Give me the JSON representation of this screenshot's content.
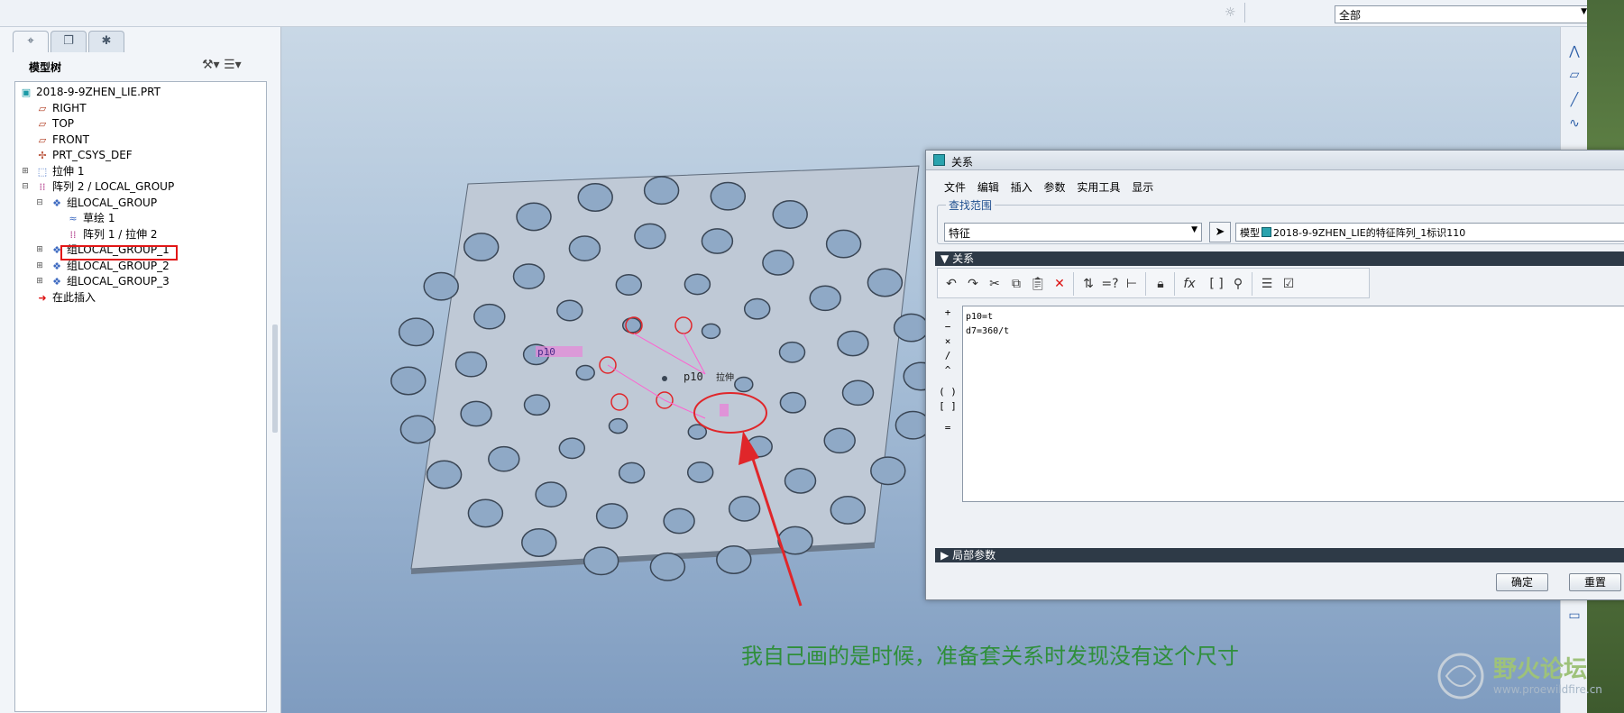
{
  "toolbar": {
    "filter_value": "全部"
  },
  "navigator": {
    "tree_title": "模型树",
    "items": [
      {
        "label": "2018-9-9ZHEN_LIE.PRT",
        "icon": "part-icon"
      },
      {
        "label": "RIGHT",
        "icon": "datum-plane-icon"
      },
      {
        "label": "TOP",
        "icon": "datum-plane-icon"
      },
      {
        "label": "FRONT",
        "icon": "datum-plane-icon"
      },
      {
        "label": "PRT_CSYS_DEF",
        "icon": "csys-icon"
      },
      {
        "label": "拉伸 1",
        "icon": "extrude-icon"
      },
      {
        "label": "阵列 2 / LOCAL_GROUP",
        "icon": "pattern-icon"
      },
      {
        "label": "组LOCAL_GROUP",
        "icon": "group-icon"
      },
      {
        "label": "草绘 1",
        "icon": "sketch-icon"
      },
      {
        "label": "阵列 1 / 拉伸 2",
        "icon": "pattern-icon"
      },
      {
        "label": "组LOCAL_GROUP_1",
        "icon": "group-icon"
      },
      {
        "label": "组LOCAL_GROUP_2",
        "icon": "group-icon"
      },
      {
        "label": "组LOCAL_GROUP_3",
        "icon": "group-icon"
      },
      {
        "label": "在此插入",
        "icon": "insert-here-icon"
      }
    ]
  },
  "scene": {
    "dim_labels": [
      "p10",
      "p10",
      "拉伸"
    ]
  },
  "dialog": {
    "title": "关系",
    "menus": [
      "文件",
      "编辑",
      "插入",
      "参数",
      "实用工具",
      "显示"
    ],
    "scope_label": "查找范围",
    "scope_value": "特征",
    "model_prefix": "模型",
    "model_value": "2018-9-9ZHEN_LIE的特征阵列_1标识110",
    "relations_header": "关系",
    "relations_lines": [
      "p10=t",
      "d7=360/t"
    ],
    "operators": [
      "+",
      "−",
      "×",
      "/",
      "^",
      "( )",
      "[ ]",
      "="
    ],
    "local_params_header": "局部参数",
    "ok_label": "确定",
    "reset_label": "重置"
  },
  "annotation": {
    "text": "我自己画的是时候，准备套关系时发现没有这个尺寸"
  },
  "watermark": {
    "title": "野火论坛",
    "url": "www.proewildfire.cn"
  },
  "colors": {
    "highlight": "#e21616",
    "annotation": "#2f8f3a",
    "accent": "#2aa3ae"
  }
}
